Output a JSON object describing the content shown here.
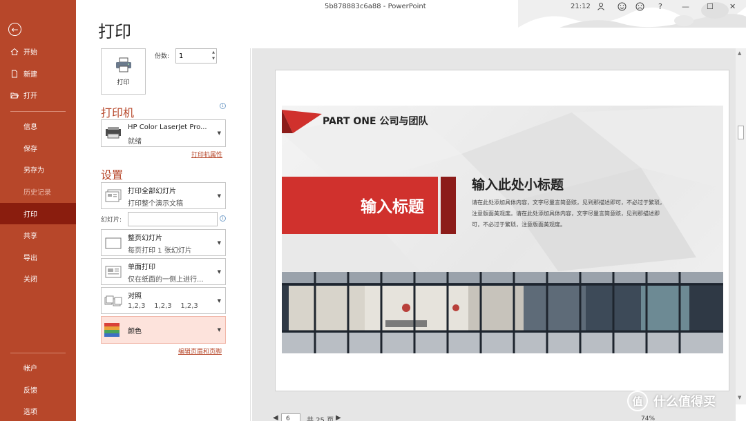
{
  "app": {
    "window_title": "5b878883c6a88 - PowerPoint",
    "time": "21:12"
  },
  "titlebar": {
    "user_icon": "user-icon",
    "smile_icon": "smile-icon",
    "frown_icon": "frown-icon",
    "help": "?",
    "minimize": "—",
    "maximize": "☐",
    "close": "✕"
  },
  "sidebar": {
    "back_icon": "arrow-left-icon",
    "top_items": [
      {
        "label": "开始",
        "icon": "home-icon"
      },
      {
        "label": "新建",
        "icon": "new-doc-icon"
      },
      {
        "label": "打开",
        "icon": "folder-open-icon"
      }
    ],
    "mid_items": [
      {
        "label": "信息"
      },
      {
        "label": "保存"
      },
      {
        "label": "另存为"
      },
      {
        "label": "历史记录",
        "state": "disabled"
      },
      {
        "label": "打印",
        "state": "selected"
      },
      {
        "label": "共享"
      },
      {
        "label": "导出"
      },
      {
        "label": "关闭"
      }
    ],
    "bottom_items": [
      {
        "label": "帐户"
      },
      {
        "label": "反馈"
      },
      {
        "label": "选项"
      }
    ],
    "colors": {
      "bg": "#b7472a",
      "active": "#8a1d0e"
    }
  },
  "main": {
    "page_title": "打印",
    "print_button_label": "打印",
    "copies": {
      "label": "份数:",
      "value": "1"
    },
    "printer": {
      "section_title": "打印机",
      "name": "HP Color LaserJet Pro...",
      "status": "就绪",
      "properties_link": "打印机属性"
    },
    "settings": {
      "section_title": "设置",
      "print_range": {
        "title": "打印全部幻灯片",
        "desc": "打印整个演示文稿"
      },
      "slides_label": "幻灯片:",
      "slides_value": "",
      "layout": {
        "title": "整页幻灯片",
        "desc": "每页打印 1 张幻灯片"
      },
      "sides": {
        "title": "单面打印",
        "desc": "仅在纸面的一侧上进行..."
      },
      "collate": {
        "title": "对照",
        "desc": "1,2,3    1,2,3    1,2,3"
      },
      "color": {
        "title": "颜色"
      },
      "header_footer_link": "编辑页眉和页脚"
    }
  },
  "preview": {
    "part": "PART  ONE  公司与团队",
    "title_box": "输入标题",
    "subtitle": "输入此处小标题",
    "body": "请在此处添加具体内容，文字尽量言简意赅，见到那描述即可，不必过于繁琐，注意版面美观度。请在此处添加具体内容，文字尽量言简意赅，见到那描述即可，不必过于繁琐，注意版面美观度。",
    "page_current": "6",
    "page_total": "共 25 页",
    "zoom": "74%"
  },
  "watermark": {
    "text": "什么值得买",
    "logo_char": "值"
  }
}
